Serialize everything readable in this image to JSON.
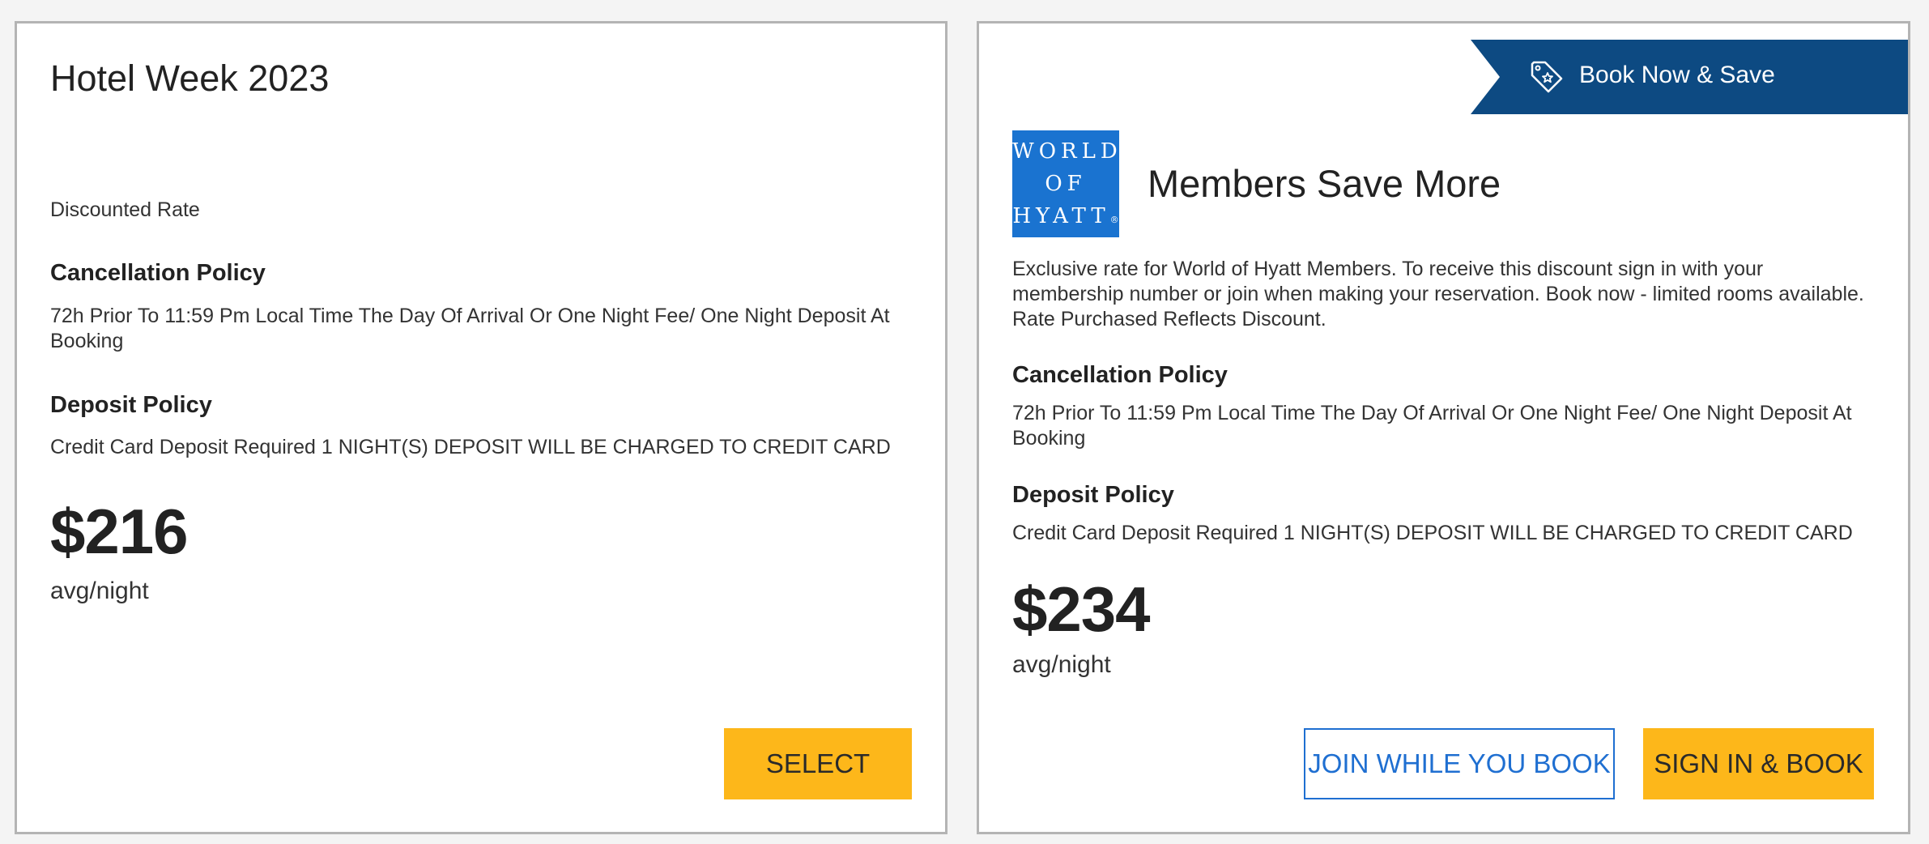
{
  "cards": [
    {
      "title": "Hotel Week 2023",
      "rate_type": "Discounted Rate",
      "cancellation_heading": "Cancellation Policy",
      "cancellation_text": "72h Prior To 11:59 Pm Local Time The Day Of Arrival Or One Night Fee/ One Night Deposit At Booking",
      "deposit_heading": "Deposit Policy",
      "deposit_text": "Credit Card Deposit Required 1 NIGHT(S) DEPOSIT WILL BE CHARGED TO CREDIT CARD",
      "price": "$216",
      "price_unit": "avg/night",
      "select_label": "SELECT"
    },
    {
      "ribbon_label": "Book Now & Save",
      "ribbon_icon": "tag-star-icon",
      "logo_lines": [
        "WORLD",
        "OF",
        "HYATT"
      ],
      "logo_mark": "®",
      "title": "Members Save More",
      "description": "Exclusive rate for World of Hyatt Members. To receive this discount sign in with your membership number or join when making your reservation. Book now - limited rooms available. Rate Purchased Reflects Discount.",
      "cancellation_heading": "Cancellation Policy",
      "cancellation_text": "72h Prior To 11:59 Pm Local Time The Day Of Arrival Or One Night Fee/ One Night Deposit At Booking",
      "deposit_heading": "Deposit Policy",
      "deposit_text": "Credit Card Deposit Required 1 NIGHT(S) DEPOSIT WILL BE CHARGED TO CREDIT CARD",
      "price": "$234",
      "price_unit": "avg/night",
      "join_label": "JOIN WHILE YOU BOOK",
      "signin_label": "SIGN IN & BOOK"
    }
  ],
  "colors": {
    "accent_yellow": "#fdb71a",
    "brand_navy": "#0d4a82",
    "brand_blue": "#1a73d0",
    "link_blue": "#1f6fd1"
  }
}
